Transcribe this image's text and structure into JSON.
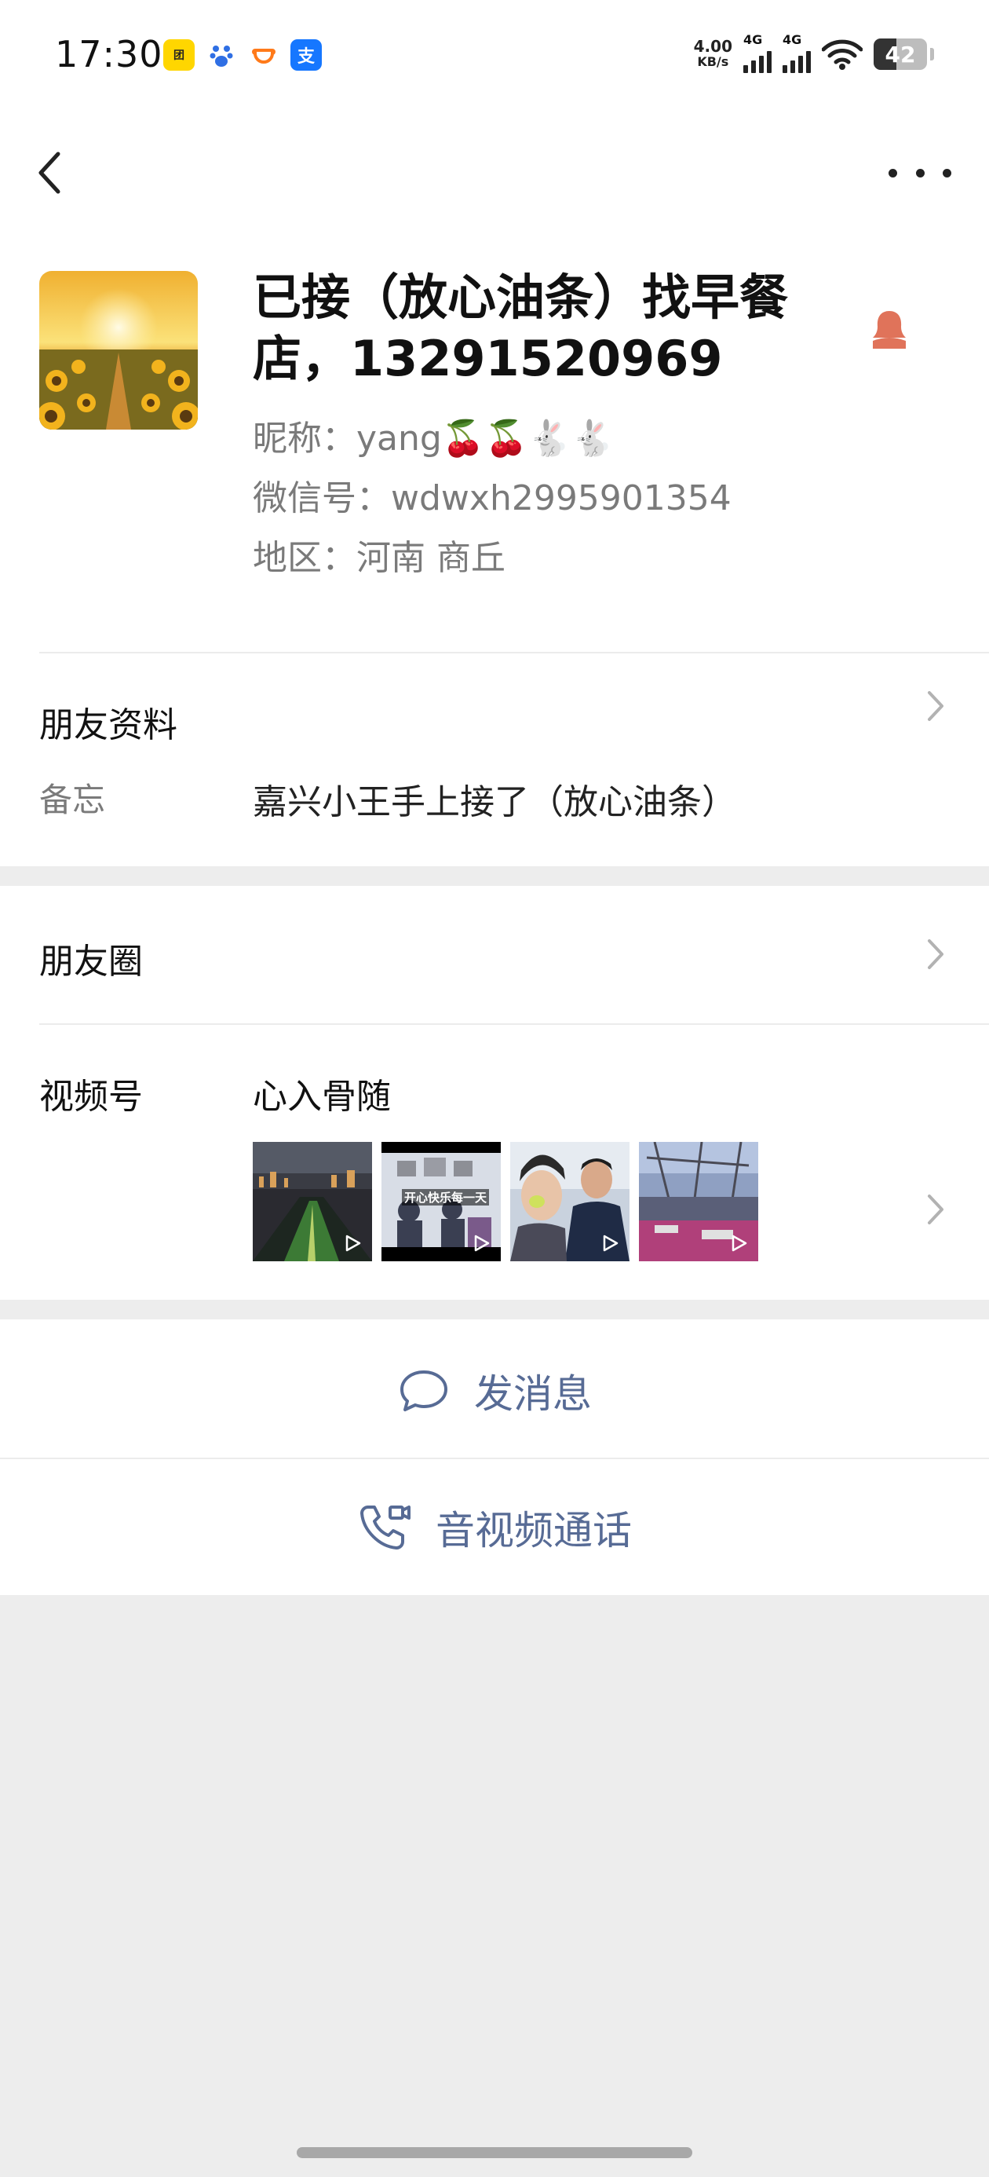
{
  "status_bar": {
    "time": "17:30",
    "network_speed_value": "4.00",
    "network_speed_unit": "KB/s",
    "network_type_1": "4G",
    "network_type_2": "4G",
    "battery": "42"
  },
  "profile": {
    "display_name": "已接（放心油条）找早餐店，13291520969",
    "nickname_label": "昵称：",
    "nickname_value": "yang🍒🍒🐇🐇",
    "wechat_id_label": "微信号：",
    "wechat_id_value": "wdwxh2995901354",
    "region_label": "地区：",
    "region_value": "河南  商丘"
  },
  "friend_info": {
    "title": "朋友资料",
    "remark_label": "备忘",
    "remark_value": "嘉兴小王手上接了（放心油条）"
  },
  "moments": {
    "title": "朋友圈"
  },
  "channels": {
    "title": "视频号",
    "name": "心入骨随",
    "thumbnail_caption": "开心快乐每一天"
  },
  "actions": {
    "message": "发消息",
    "call": "音视频通话"
  },
  "colors": {
    "link": "#576b95",
    "background": "#ededed",
    "gender_icon": "#e0735a"
  }
}
